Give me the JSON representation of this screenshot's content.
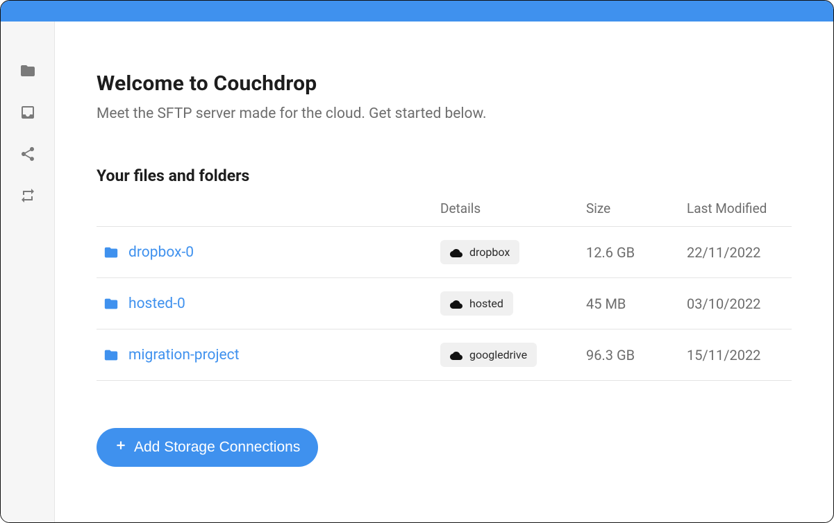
{
  "header": {
    "title": "Welcome to Couchdrop",
    "subtitle": "Meet the SFTP server made for the cloud. Get started below."
  },
  "section": {
    "title": "Your files and folders",
    "columns": {
      "details": "Details",
      "size": "Size",
      "modified": "Last Modified"
    }
  },
  "rows": [
    {
      "name": "dropbox-0",
      "provider": "dropbox",
      "size": "12.6 GB",
      "modified": "22/11/2022"
    },
    {
      "name": "hosted-0",
      "provider": "hosted",
      "size": "45 MB",
      "modified": "03/10/2022"
    },
    {
      "name": "migration-project",
      "provider": "googledrive",
      "size": "96.3 GB",
      "modified": "15/11/2022"
    }
  ],
  "actions": {
    "add_storage": "Add Storage Connections"
  },
  "sidebar": {
    "items": [
      "folder",
      "inbox",
      "share",
      "transfer"
    ]
  },
  "colors": {
    "accent": "#3f91ee"
  }
}
